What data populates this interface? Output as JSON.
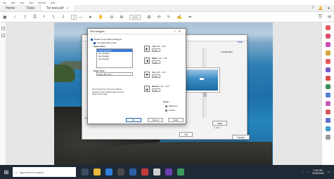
{
  "menubar": {
    "items": [
      "File",
      "Edit",
      "View",
      "Sign",
      "Window",
      "Help"
    ]
  },
  "tabs": {
    "home": "Home",
    "tools": "Tools",
    "document": "Tst test.pdf"
  },
  "toolbar": {
    "current_page": "1",
    "total_pages": "/ 1",
    "zoom": "62%",
    "share": "Share"
  },
  "bg_dialog": {
    "title": "CX 2990 Properties",
    "help_link": "Help",
    "orientation_text": "Landscape",
    "page_of": "1 of 1",
    "help_btn": "Help",
    "ok": "OK",
    "cancel": "Cancel",
    "left_label": "High Graph ▾"
  },
  "margins": {
    "title": "Print Margins",
    "enable_user_defined": "Enable User Defined Margins",
    "for_each_paper": "For Each Paper Size",
    "paper_sizes_label": "Paper Sizes:",
    "paper_list": [
      "Letter (8.5x11\")",
      "Item Default",
      "Item Default",
      "Item Default"
    ],
    "paper_size_label": "Paper Size:",
    "paper_size_value": "Letter (8.5 x 11\")",
    "left": {
      "label": "Left",
      "range": "0.00 - 7.91\"",
      "value": "0.00"
    },
    "right": {
      "label": "Right",
      "range": "0.00 - 7.91\"",
      "value": "0.00"
    },
    "top": {
      "label": "Top",
      "range": "0.00 - 7.91\"",
      "value": "0.00"
    },
    "bottom": {
      "label": "Bottom",
      "range": "0.00 - 7.91\"",
      "value": "0.00"
    },
    "note": "Print Outputs the document without printing on the specified area from the edges of the page.",
    "units_label": "Units:",
    "units": [
      "Millimeter",
      "Inches"
    ],
    "selected_unit": "Inches",
    "ok": "OK",
    "cancel": "Cancel",
    "help": "Help"
  },
  "taskbar": {
    "search_placeholder": "Type here to search",
    "time": "2:25 PM",
    "date": "11/26/2020"
  }
}
